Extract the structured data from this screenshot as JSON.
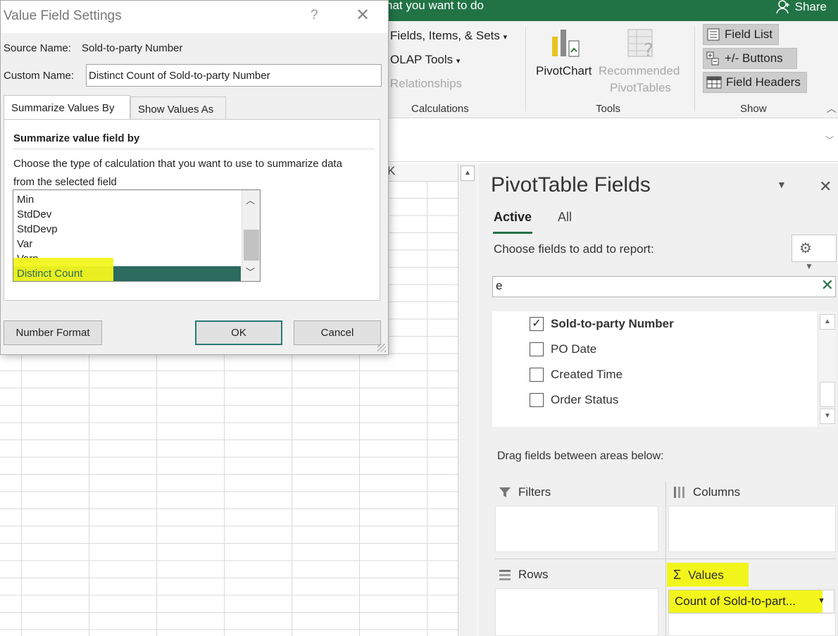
{
  "ribbon": {
    "tell_me": "hat you want to do",
    "share": "Share",
    "fields_items_sets": "Fields, Items, & Sets",
    "olap_tools": "OLAP Tools",
    "relationships": "Relationships",
    "group_calculations": "Calculations",
    "pivotchart": "PivotChart",
    "recommended_1": "Recommended",
    "recommended_2": "PivotTables",
    "group_tools": "Tools",
    "field_list": "Field List",
    "buttons": "+/- Buttons",
    "field_headers": "Field Headers",
    "group_show": "Show"
  },
  "grid": {
    "column_k": "K"
  },
  "dialog": {
    "title": "Value Field Settings",
    "help": "?",
    "close": "✕",
    "source_label": "Source Name:",
    "source_value": "Sold-to-party Number",
    "custom_label": "Custom Name:",
    "custom_value": "Distinct Count of Sold-to-party Number",
    "tabs": [
      "Summarize Values By",
      "Show Values As"
    ],
    "section_heading": "Summarize value field by",
    "description": "Choose the type of calculation that you want to use to summarize data from the selected field",
    "list_items": [
      "Min",
      "StdDev",
      "StdDevp",
      "Var",
      "Varp",
      "Distinct Count"
    ],
    "selected_item": "Distinct Count",
    "number_format_button": "Number Format",
    "ok_button": "OK",
    "cancel_button": "Cancel"
  },
  "pane": {
    "title": "PivotTable Fields",
    "tab_active": "Active",
    "tab_all": "All",
    "choose_label": "Choose fields to add to report:",
    "search_value": "e",
    "fields": [
      {
        "name": "Sold-to-party Number",
        "checked": true
      },
      {
        "name": "PO Date",
        "checked": false
      },
      {
        "name": "Created Time",
        "checked": false
      },
      {
        "name": "Order Status",
        "checked": false
      }
    ],
    "drag_label": "Drag fields between areas below:",
    "areas": {
      "filters": "Filters",
      "columns": "Columns",
      "rows": "Rows",
      "values": "Values"
    },
    "values_item": "Count of Sold-to-part..."
  },
  "colors": {
    "excel_green": "#217346",
    "selection": "#2c6b5e",
    "highlight": "#f2f51c"
  },
  "icons": [
    "share-person-icon",
    "pivotchart-icon",
    "recommended-pivottables-icon",
    "field-list-icon",
    "plus-minus-buttons-icon",
    "field-headers-icon",
    "gear-icon",
    "filter-icon",
    "columns-icon",
    "rows-icon",
    "sigma-icon",
    "close-icon",
    "help-icon"
  ]
}
